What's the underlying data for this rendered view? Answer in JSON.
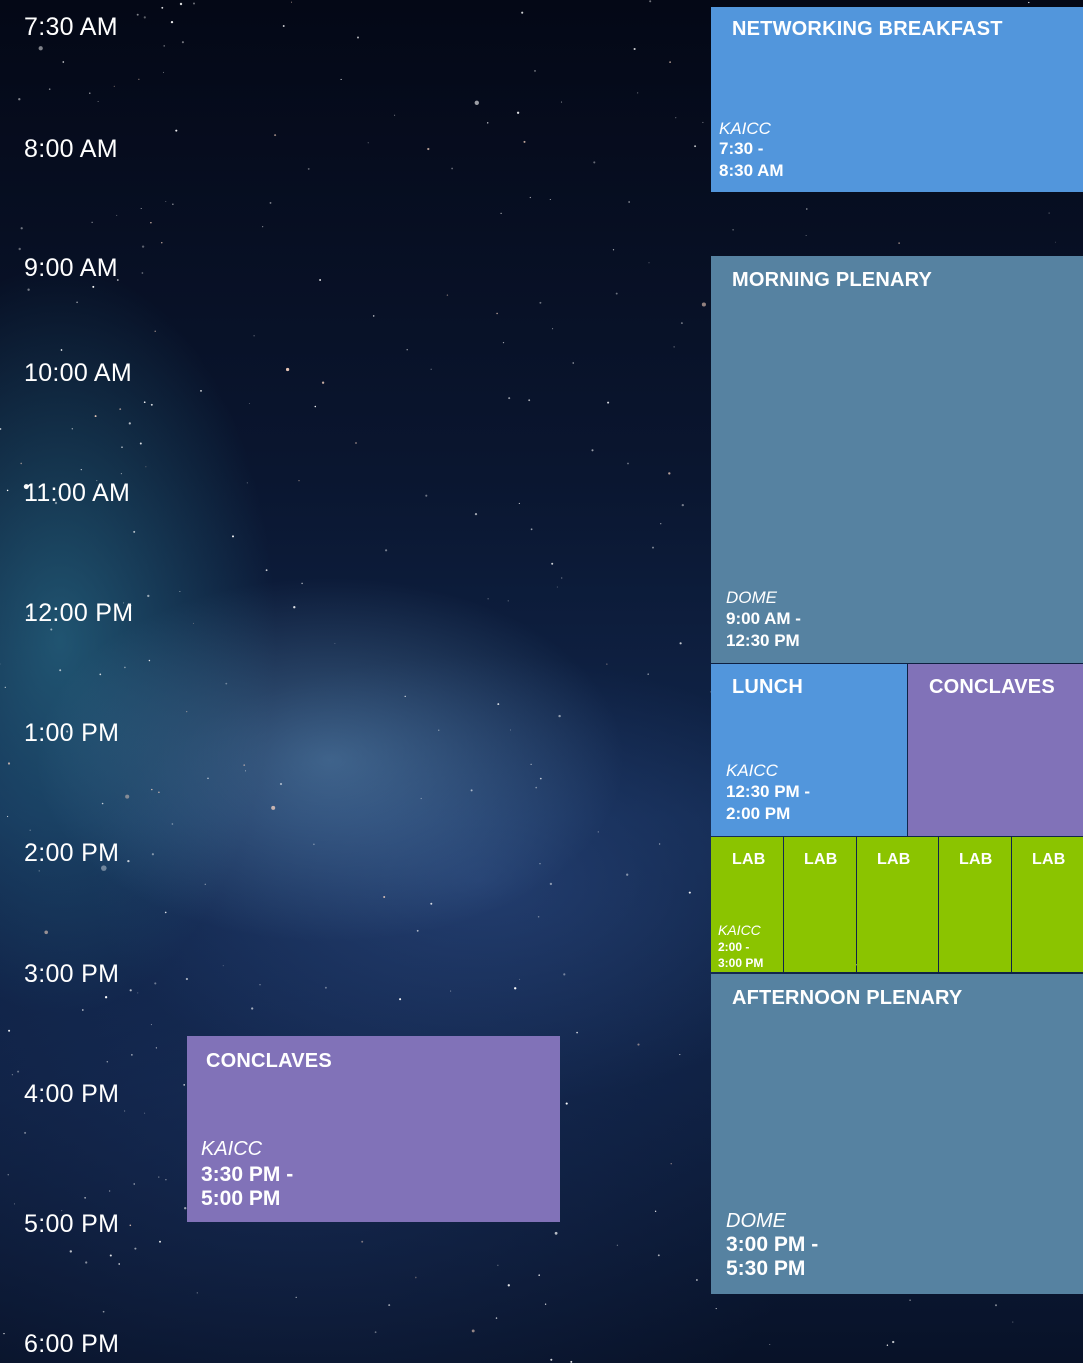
{
  "times": [
    "7:30 AM",
    "8:00 AM",
    "9:00 AM",
    "10:00 AM",
    "11:00 AM",
    "12:00 PM",
    "1:00 PM",
    "2:00 PM",
    "3:00 PM",
    "4:00 PM",
    "5:00 PM",
    "6:00 PM"
  ],
  "sessions": {
    "breakfast": {
      "title": "NETWORKING BREAKFAST",
      "location": "KAICC",
      "time_start": "7:30 -",
      "time_end": "8:30 AM",
      "color": "#5296dc"
    },
    "morning_plenary": {
      "title": "MORNING PLENARY",
      "location": "DOME",
      "time_start": "9:00 AM -",
      "time_end": "12:30 PM",
      "color": "#5682a1"
    },
    "lunch": {
      "title": "LUNCH",
      "location": "KAICC",
      "time_start": "12:30 PM -",
      "time_end": "2:00 PM",
      "color": "#5296dc"
    },
    "conclaves_right": {
      "title": "CONCLAVES",
      "color": "#8172b8"
    },
    "labs": {
      "label": "LAB",
      "location": "KAICC",
      "time_start": "2:00 -",
      "time_end": "3:00 PM",
      "count": 5,
      "color": "#8bc400"
    },
    "afternoon_plenary": {
      "title": "AFTERNOON PLENARY",
      "location": "DOME",
      "time_start": "3:00 PM -",
      "time_end": "5:30 PM",
      "color": "#5682a1"
    },
    "conclaves_left": {
      "title": "CONCLAVES",
      "location": "KAICC",
      "time_start": "3:30 PM -",
      "time_end": "5:00 PM",
      "color": "#8172b8"
    }
  }
}
